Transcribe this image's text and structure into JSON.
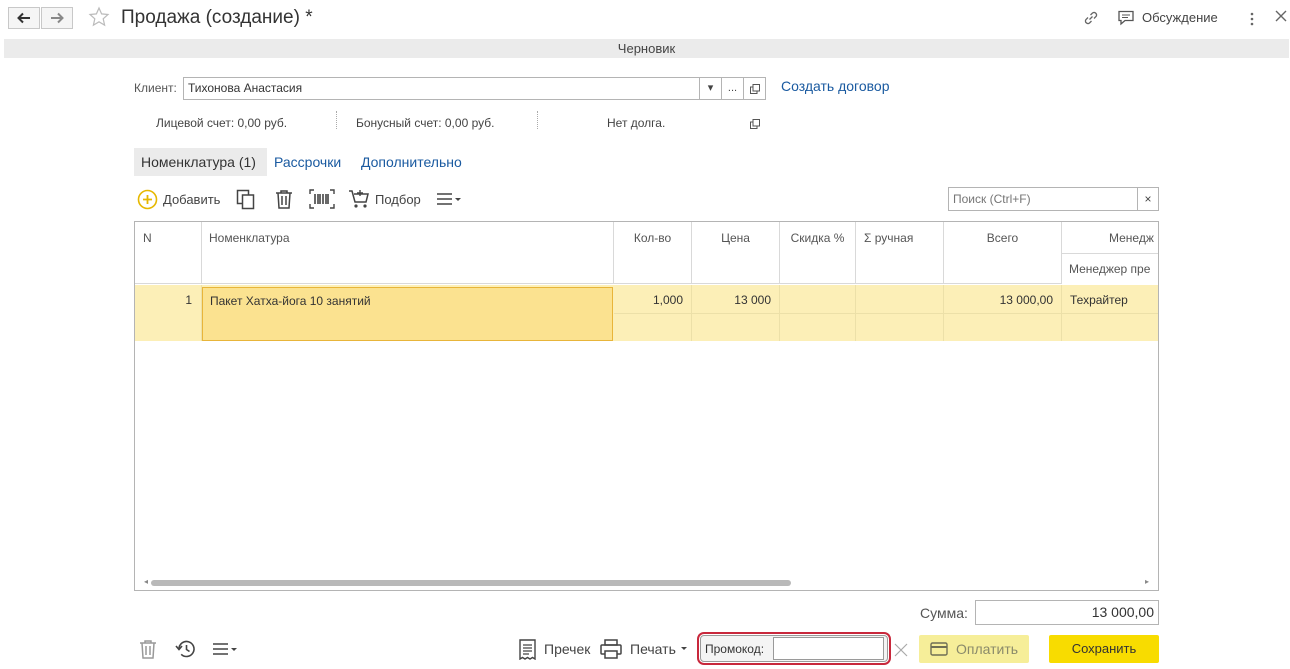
{
  "window": {
    "title": "Продажа (создание) *",
    "discussion_label": "Обсуждение",
    "status": "Черновик"
  },
  "client": {
    "label": "Клиент:",
    "value": "Тихонова Анастасия",
    "dropdown_glyph": "▾",
    "select_glyph": "...",
    "create_contract_link": "Создать договор"
  },
  "account_info": {
    "personal_account": "Лицевой счет: 0,00  руб.",
    "bonus_account": "Бонусный счет: 0,00  руб.",
    "debt": "Нет долга."
  },
  "tabs": [
    {
      "label": "Номенклатура (1)",
      "active": true
    },
    {
      "label": "Рассрочки",
      "active": false
    },
    {
      "label": "Дополнительно",
      "active": false
    }
  ],
  "toolbar": {
    "add_label": "Добавить",
    "selection_label": "Подбор",
    "search_placeholder": "Поиск (Ctrl+F)",
    "search_clear": "×"
  },
  "table": {
    "columns": [
      "N",
      "Номенклатура",
      "Кол-во",
      "Цена",
      "Скидка %",
      "Σ ручная",
      "Всего",
      "Менедж"
    ],
    "subheader": "Менеджер пре",
    "rows": [
      {
        "n": "1",
        "item": "Пакет Хатха-йога 10 занятий",
        "qty": "1,000",
        "price": "13 000",
        "discount": "",
        "manual_sum": "",
        "total": "13 000,00",
        "manager": "Техрайтер"
      }
    ]
  },
  "summary": {
    "sum_label": "Сумма:",
    "sum_value": "13 000,00"
  },
  "bottom": {
    "precheck_label": "Пречек",
    "print_label": "Печать",
    "promo_label": "Промокод:",
    "promo_value": "",
    "pay_label": "Оплатить",
    "save_label": "Сохранить"
  },
  "colors": {
    "accent_yellow": "#f8dc00",
    "selected_row": "#fcefb7",
    "active_cell": "#fbe290",
    "link": "#1a5aa0",
    "promo_highlight": "#c8283c"
  }
}
